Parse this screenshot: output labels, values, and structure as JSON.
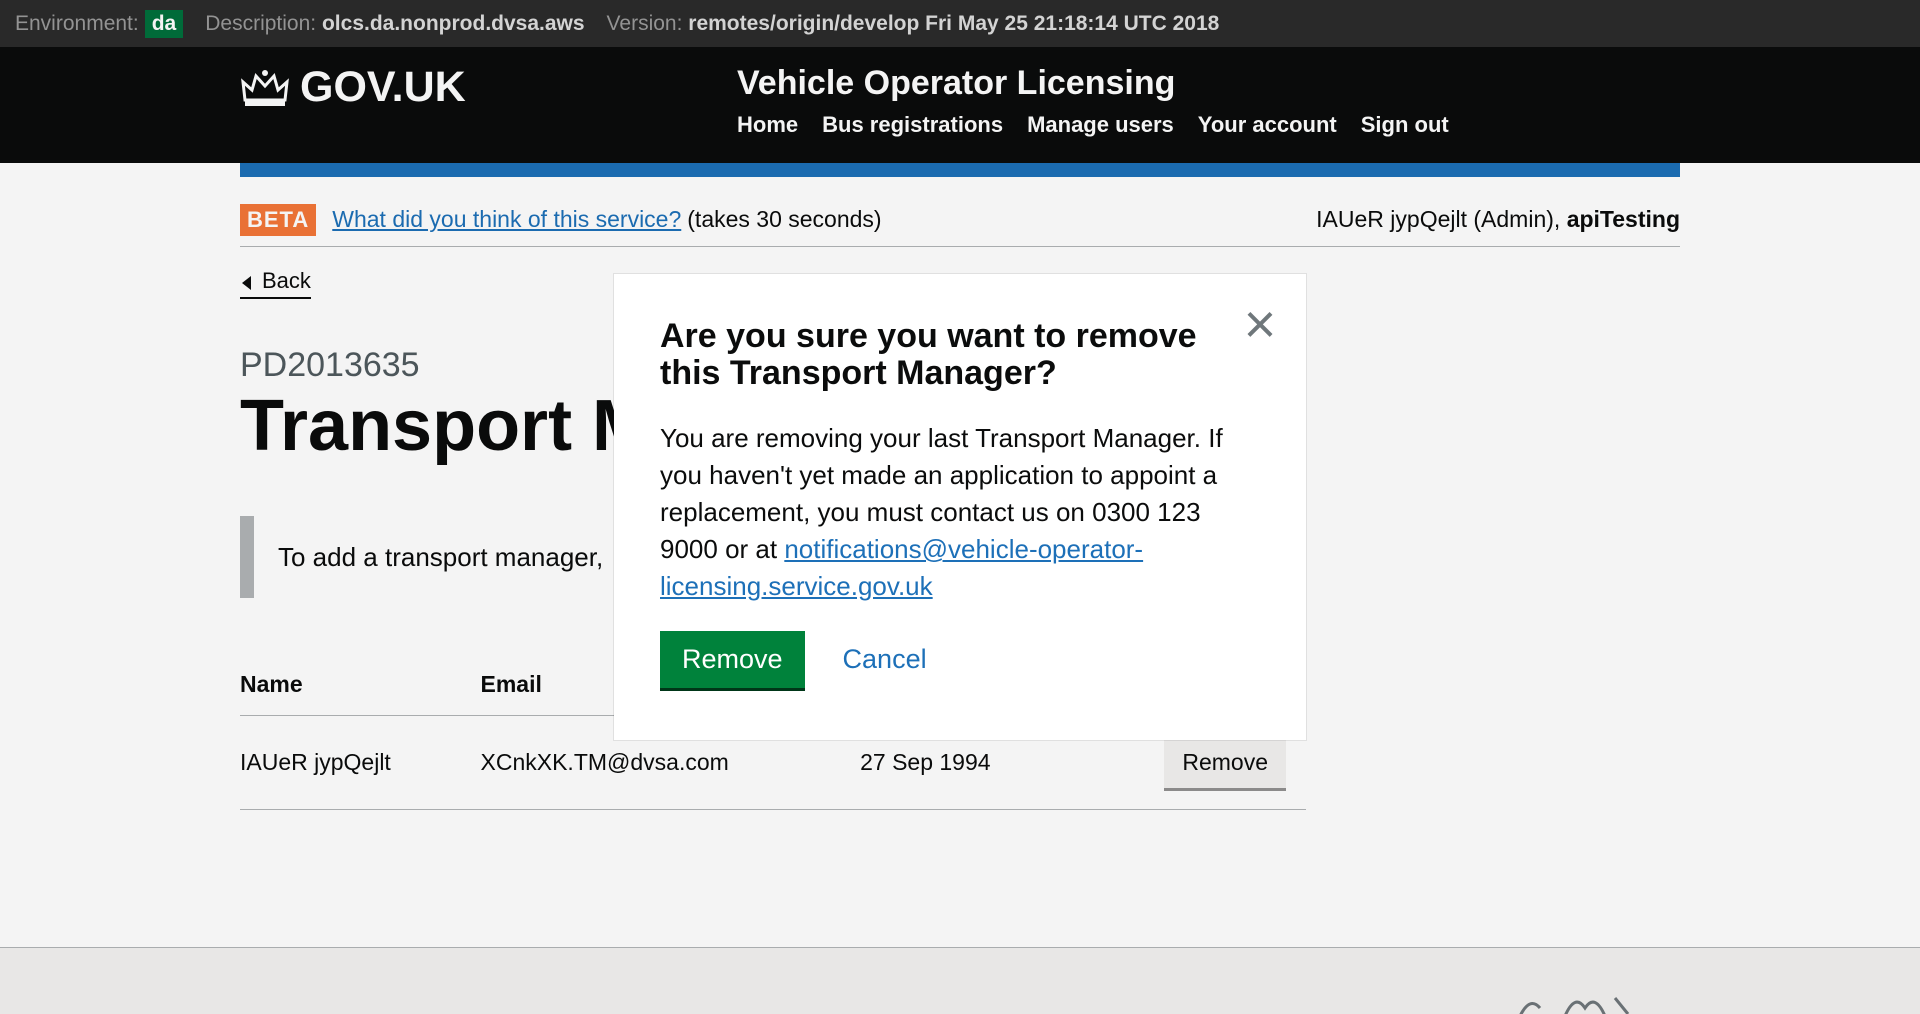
{
  "env": {
    "environment_label": "Environment:",
    "environment_value": "da",
    "description_label": "Description:",
    "description_value": "olcs.da.nonprod.dvsa.aws",
    "version_label": "Version:",
    "version_value": "remotes/origin/develop Fri May 25 21:18:14 UTC 2018"
  },
  "header": {
    "logo_text": "GOV.UK",
    "service_name": "Vehicle Operator Licensing",
    "nav": [
      "Home",
      "Bus registrations",
      "Manage users",
      "Your account",
      "Sign out"
    ]
  },
  "phase": {
    "tag": "BETA",
    "feedback_link": "What did you think of this service?",
    "feedback_suffix": "(takes 30 seconds)",
    "user_name": "IAUeR jypQejlt (Admin),",
    "org": "apiTesting"
  },
  "back_label": "Back",
  "page": {
    "caption": "PD2013635",
    "title": "Transport Managers",
    "inset_text": "To add a transport manager,"
  },
  "table": {
    "headers": [
      "Name",
      "Email",
      "",
      ""
    ],
    "rows": [
      {
        "name": "IAUeR jypQejlt",
        "email": "XCnkXK.TM@dvsa.com",
        "dob": "27 Sep 1994",
        "action": "Remove"
      }
    ]
  },
  "modal": {
    "title": "Are you sure you want to remove this Transport Manager?",
    "body_text": "You are removing your last Transport Manager. If you haven't yet made an application to appoint a replacement, you must contact us on 0300 123 9000 or at ",
    "email_link": "notifications@vehicle-operator-licensing.service.gov.uk",
    "remove_label": "Remove",
    "cancel_label": "Cancel",
    "close_symbol": "×"
  },
  "colors": {
    "header_bg": "#0b0c0c",
    "accent_blue": "#1d70b8",
    "beta_orange": "#f47738",
    "button_green": "#00823b",
    "env_badge_green": "#00703c"
  }
}
